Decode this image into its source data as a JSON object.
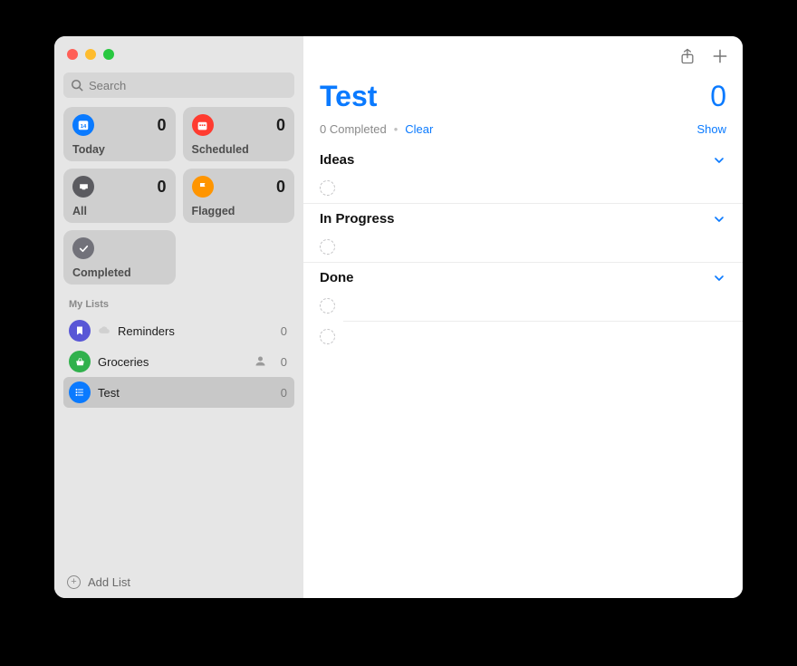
{
  "search": {
    "placeholder": "Search",
    "value": ""
  },
  "smart": {
    "today": {
      "label": "Today",
      "count": "0"
    },
    "scheduled": {
      "label": "Scheduled",
      "count": "0"
    },
    "all": {
      "label": "All",
      "count": "0"
    },
    "flagged": {
      "label": "Flagged",
      "count": "0"
    },
    "completed": {
      "label": "Completed"
    }
  },
  "mylists_heading": "My Lists",
  "lists": [
    {
      "name": "Reminders",
      "count": "0",
      "color": "#5856d6",
      "glyph": "bookmark",
      "cloud": true,
      "shared": false,
      "selected": false
    },
    {
      "name": "Groceries",
      "count": "0",
      "color": "#30b14c",
      "glyph": "basket",
      "cloud": false,
      "shared": true,
      "selected": false
    },
    {
      "name": "Test",
      "count": "0",
      "color": "#0a7aff",
      "glyph": "list",
      "cloud": false,
      "shared": false,
      "selected": true
    }
  ],
  "addlist_label": "Add List",
  "main": {
    "title": "Test",
    "count": "0",
    "completed_line": "0 Completed",
    "clear": "Clear",
    "show": "Show"
  },
  "sections": [
    {
      "name": "Ideas"
    },
    {
      "name": "In Progress"
    },
    {
      "name": "Done"
    }
  ]
}
